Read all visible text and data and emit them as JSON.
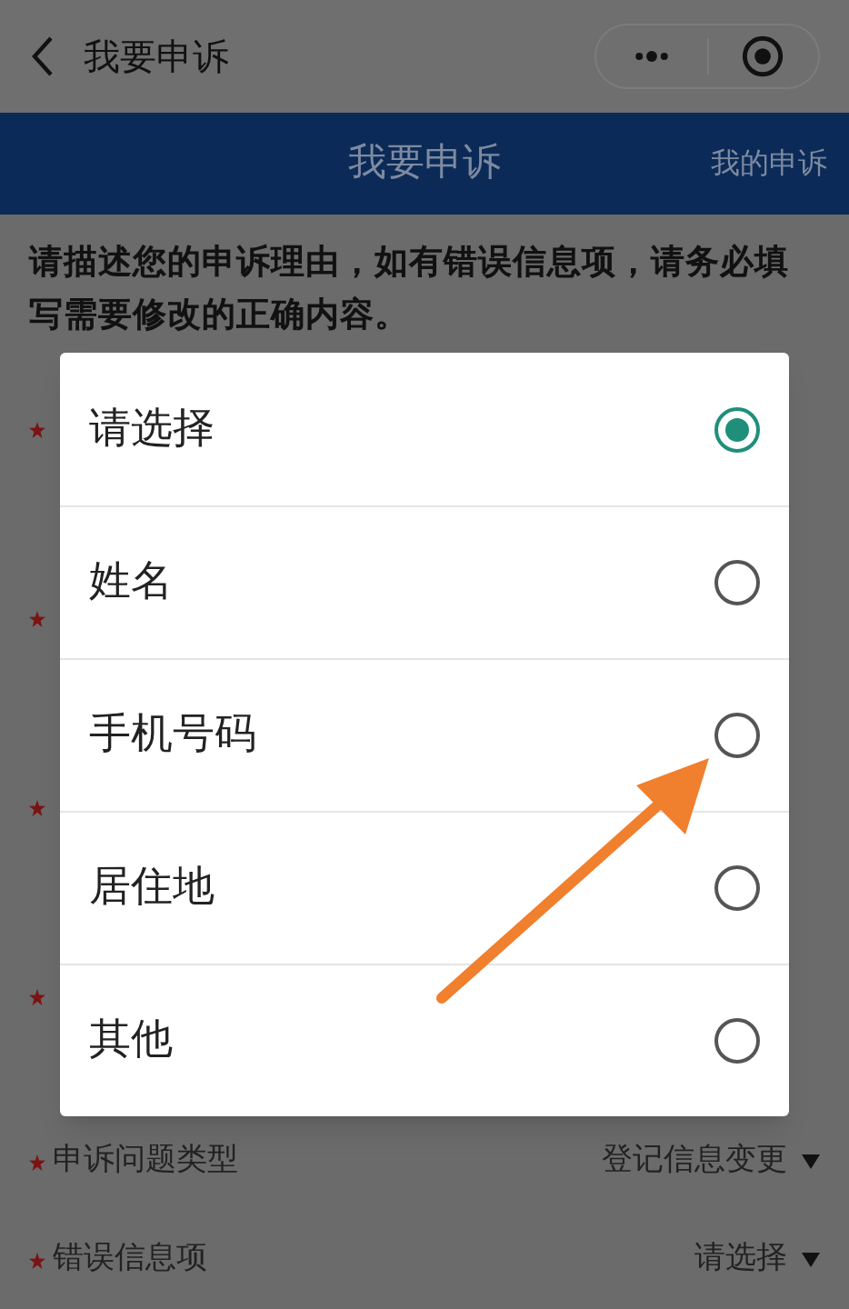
{
  "nav_bar": {
    "title": "我要申诉"
  },
  "header": {
    "title": "我要申诉",
    "link": "我的申诉"
  },
  "description": "请描述您的申诉理由，如有错误信息项，请务必填写需要修改的正确内容。",
  "picker": {
    "options": [
      {
        "label": "请选择",
        "selected": true
      },
      {
        "label": "姓名",
        "selected": false
      },
      {
        "label": "手机号码",
        "selected": false
      },
      {
        "label": "居住地",
        "selected": false
      },
      {
        "label": "其他",
        "selected": false
      }
    ]
  },
  "form": {
    "fields": [
      {
        "label": "申诉问题类型",
        "value": "登记信息变更"
      },
      {
        "label": "错误信息项",
        "value": "请选择"
      }
    ]
  }
}
